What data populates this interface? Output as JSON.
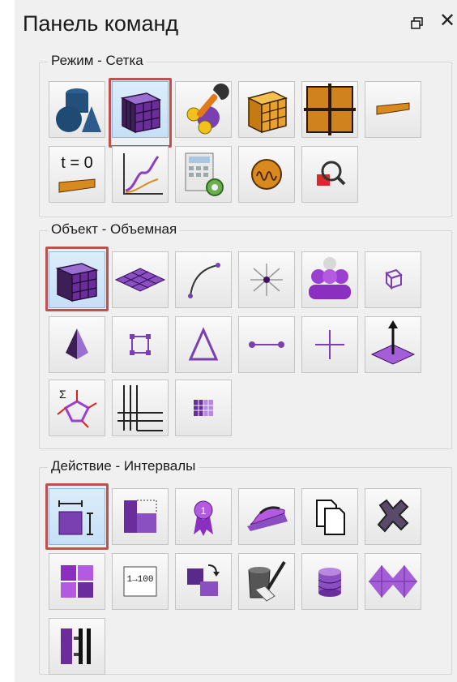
{
  "panel": {
    "title": "Панель команд",
    "title_buttons": [
      "pin-icon",
      "close-icon"
    ],
    "close_glyph": "✕"
  },
  "groups": [
    {
      "label": "Режим - Сетка",
      "buttons": [
        {
          "icon": "geometry-shapes-icon",
          "active": false
        },
        {
          "icon": "volume-mesh-cube-icon",
          "active": true,
          "highlighted": true
        },
        {
          "icon": "mesh-tools-wrench-icon",
          "active": false
        },
        {
          "icon": "orange-block-cube-icon",
          "active": false
        },
        {
          "icon": "grid-quad-blocks-icon",
          "active": false
        },
        {
          "icon": "edge-band-icon",
          "active": false
        },
        {
          "icon": "time-zero-icon",
          "active": false,
          "text": "t = 0"
        },
        {
          "icon": "chart-curve-icon",
          "active": false
        },
        {
          "icon": "calculator-gear-icon",
          "active": false
        },
        {
          "icon": "wave-signal-icon",
          "active": false
        },
        {
          "icon": "zoom-inspect-icon",
          "active": false
        }
      ]
    },
    {
      "label": "Объект - Объемная",
      "buttons": [
        {
          "icon": "volume-object-cube-icon",
          "active": true,
          "highlighted": true
        },
        {
          "icon": "surface-mesh-plane-icon",
          "active": false
        },
        {
          "icon": "curve-edge-icon",
          "active": false
        },
        {
          "icon": "vertex-star-icon",
          "active": false
        },
        {
          "icon": "group-assembly-icon",
          "active": false
        },
        {
          "icon": "small-block-icon",
          "active": false
        },
        {
          "icon": "pyramid-icon",
          "active": false
        },
        {
          "icon": "face-square-icon",
          "active": false
        },
        {
          "icon": "triangle-icon",
          "active": false
        },
        {
          "icon": "line-segment-icon",
          "active": false
        },
        {
          "icon": "point-cross-icon",
          "active": false
        },
        {
          "icon": "normal-vector-icon",
          "active": false
        },
        {
          "icon": "sum-links-icon",
          "active": false
        },
        {
          "icon": "layers-grid-icon",
          "active": false
        },
        {
          "icon": "small-grid-icon",
          "active": false
        }
      ]
    },
    {
      "label": "Действие - Интервалы",
      "buttons": [
        {
          "icon": "interval-edit-icon",
          "active": true,
          "highlighted": true
        },
        {
          "icon": "split-blocks-icon",
          "active": false
        },
        {
          "icon": "award-ribbon-icon",
          "active": false
        },
        {
          "icon": "smooth-iron-icon",
          "active": false
        },
        {
          "icon": "copy-document-icon",
          "active": false
        },
        {
          "icon": "delete-cross-icon",
          "active": false
        },
        {
          "icon": "merge-blocks-icon",
          "active": false
        },
        {
          "icon": "count-1-100-icon",
          "active": false,
          "text": "1→100"
        },
        {
          "icon": "transfer-blocks-icon",
          "active": false
        },
        {
          "icon": "paint-bucket-icon",
          "active": false
        },
        {
          "icon": "database-cylinder-icon",
          "active": false
        },
        {
          "icon": "diamond-mesh-icon",
          "active": false
        },
        {
          "icon": "distribute-bars-icon",
          "active": false
        }
      ]
    }
  ],
  "colors": {
    "highlight": "#c0504d",
    "active_bg": "#c7e0f7",
    "purple": "#7a3fb0",
    "orange": "#d98a1f"
  }
}
